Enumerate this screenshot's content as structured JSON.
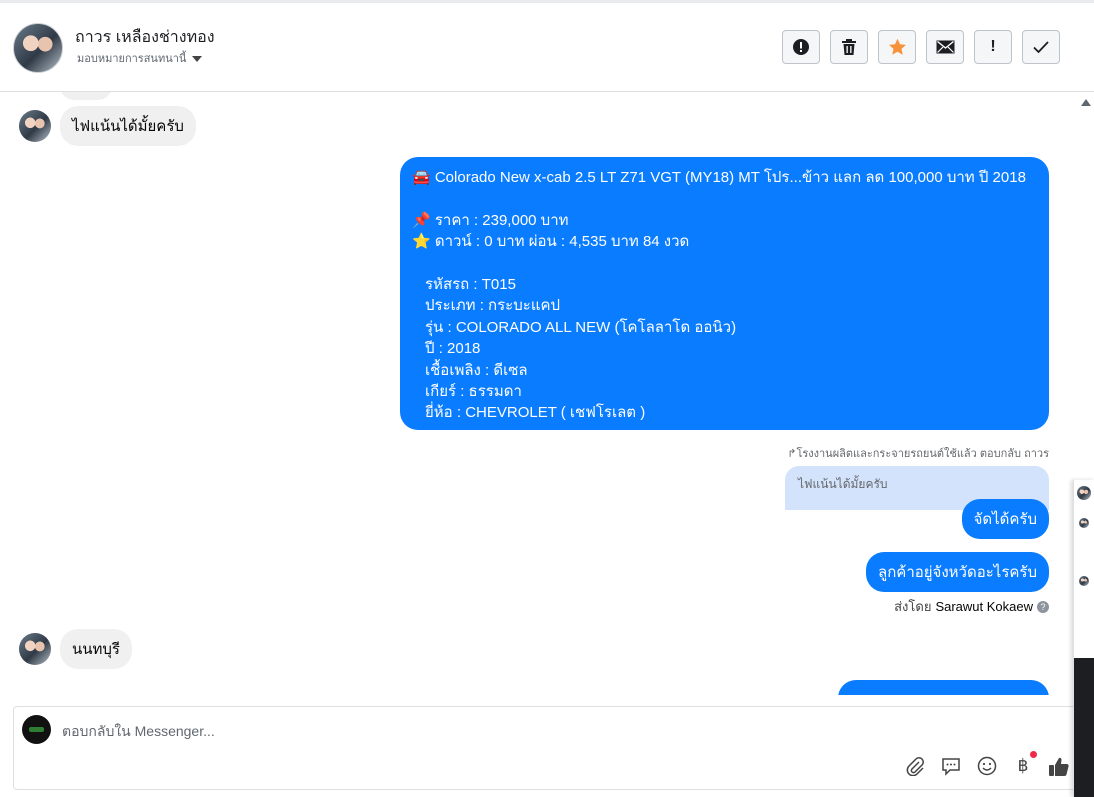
{
  "header": {
    "contact_name": "ถาวร เหลืองช่างทอง",
    "assign_label": "มอบหมายการสนทนานี้",
    "actions": [
      {
        "name": "spam-button",
        "icon": "!"
      },
      {
        "name": "delete-button",
        "icon": "🗑"
      },
      {
        "name": "star-button",
        "icon": "★"
      },
      {
        "name": "mark-unread-button",
        "icon": "✉"
      },
      {
        "name": "follow-up-button",
        "icon": "!"
      },
      {
        "name": "done-button",
        "icon": "✓"
      }
    ]
  },
  "messages": {
    "m1": "ไฟแน้นได้มั้ยครับ",
    "listing_lines": [
      "🚘 Colorado New x-cab 2.5 LT Z71 VGT (MY18) MT โปร...ข้าว แลก ลด 100,000 บาท ปี 2018",
      "",
      "📌 ราคา : 239,000 บาท",
      "⭐ ดาวน์ : 0 บาท ผ่อน : 4,535 บาท 84 งวด",
      "",
      "รหัสรถ : T015",
      "ประเภท : กระบะแคป",
      "รุ่น : COLORADO ALL NEW (โคโลลาโด ออนิว)",
      "ปี : 2018",
      "เชื้อเพลิง : ดีเซล",
      "เกียร์ : ธรรมดา",
      "ยี่ห้อ : CHEVROLET ( เชฟโรเลต )"
    ],
    "reply_meta": "↱โรงงานผลิตและกระจายรถยนต์ใช้แล้ว ตอบกลับ ถาวร",
    "quoted": "ไฟแน้นได้มั้ยครับ",
    "reply1": "จัดได้ครับ",
    "reply2": "ลูกค้าอยู่จังหวัดอะไรครับ",
    "sent_by_prefix": "ส่งโดย",
    "sent_by_name": "Sarawut Kokaew",
    "m_last_in": "นนทบุรี"
  },
  "composer": {
    "placeholder": "ตอบกลับใน Messenger..."
  },
  "colors": {
    "outgoing": "#0a7cff",
    "incoming": "#f0f0f0",
    "star": "#f7923b"
  }
}
